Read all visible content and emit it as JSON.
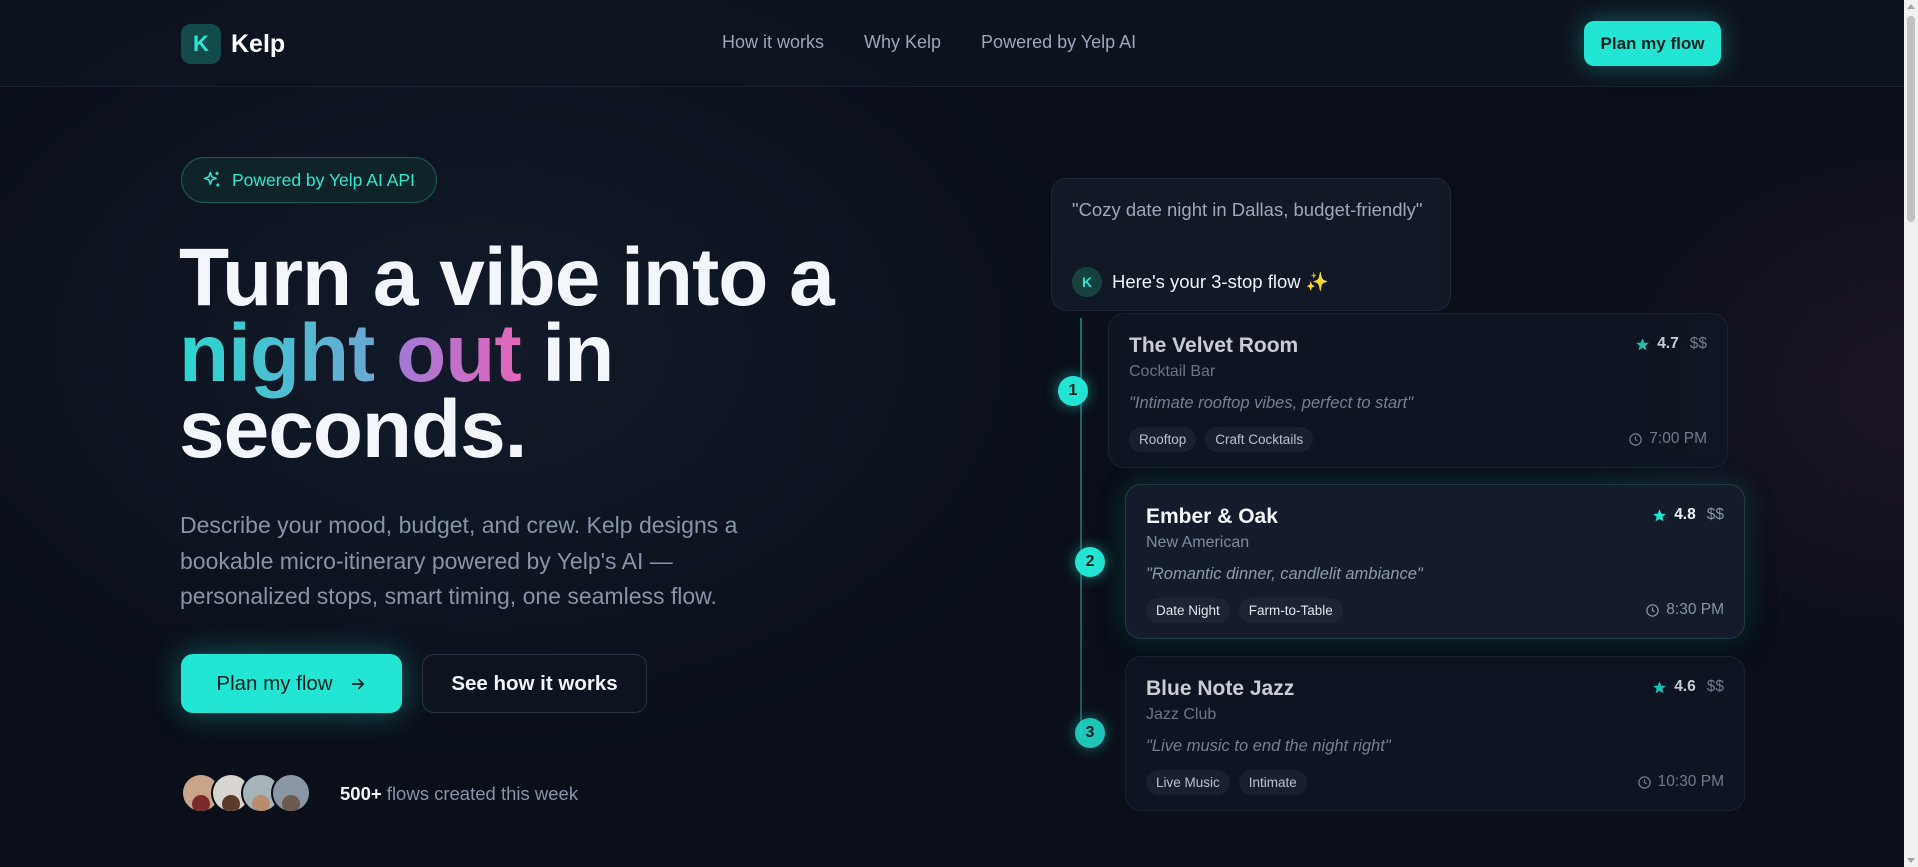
{
  "nav": {
    "logo_letter": "K",
    "logo_text": "Kelp",
    "links": [
      "How it works",
      "Why Kelp",
      "Powered by Yelp AI"
    ],
    "cta": "Plan my flow"
  },
  "hero": {
    "badge": "Powered by Yelp AI API",
    "title_line1": "Turn a vibe into a",
    "title_night": "night",
    "title_out": "out",
    "title_in": " in",
    "title_line3": "seconds.",
    "subtitle": "Describe your mood, budget, and crew. Kelp designs a bookable micro-itinerary powered by Yelp's AI — personalized stops, smart timing, one seamless flow.",
    "primary_button": "Plan my flow",
    "secondary_button": "See how it works",
    "social_count": "500+",
    "social_text": " flows created this week"
  },
  "preview": {
    "prompt": "\"Cozy date night in Dallas, budget-friendly\"",
    "reply_letter": "K",
    "reply": "Here's your 3-stop flow ✨",
    "stops": [
      {
        "step": "1",
        "name": "The Velvet Room",
        "category": "Cocktail Bar",
        "quote": "\"Intimate rooftop vibes, perfect to start\"",
        "rating": "4.7",
        "price": "$$",
        "tags": [
          "Rooftop",
          "Craft Cocktails"
        ],
        "time": "7:00 PM"
      },
      {
        "step": "2",
        "name": "Ember & Oak",
        "category": "New American",
        "quote": "\"Romantic dinner, candlelit ambiance\"",
        "rating": "4.8",
        "price": "$$",
        "tags": [
          "Date Night",
          "Farm-to-Table"
        ],
        "time": "8:30 PM"
      },
      {
        "step": "3",
        "name": "Blue Note Jazz",
        "category": "Jazz Club",
        "quote": "\"Live music to end the night right\"",
        "rating": "4.6",
        "price": "$$",
        "tags": [
          "Live Music",
          "Intimate"
        ],
        "time": "10:30 PM"
      }
    ]
  },
  "colors": {
    "accent": "#22e6d3",
    "background": "#0a0f19",
    "gradient_night": "#2ad7cf",
    "gradient_out": "#e567b9"
  },
  "icons": [
    "sparkles-icon",
    "arrow-right-icon",
    "star-icon",
    "clock-icon"
  ]
}
